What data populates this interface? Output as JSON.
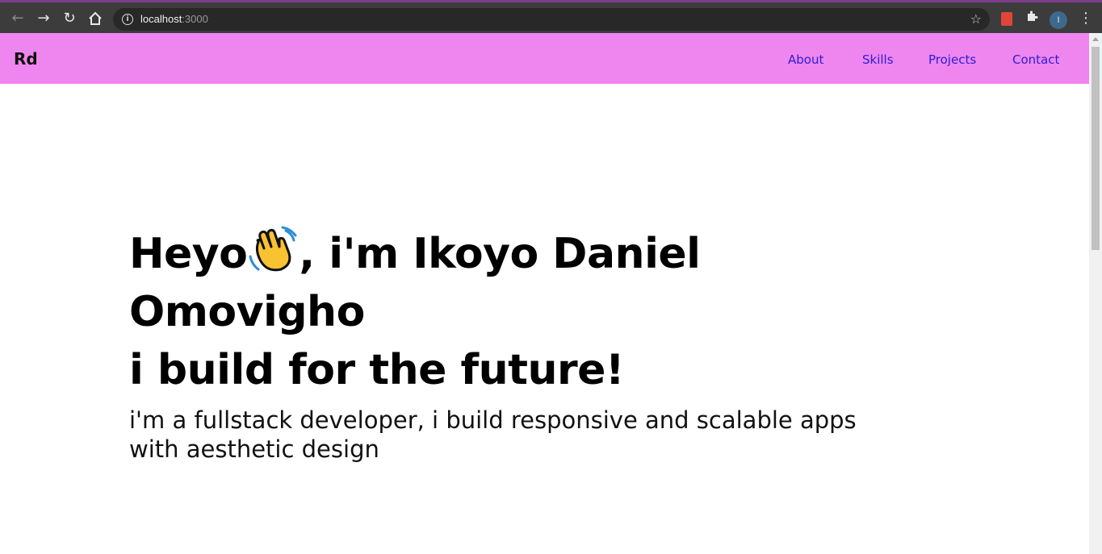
{
  "browser": {
    "url_host": "localhost",
    "url_port": ":3000",
    "profile_initial": "I",
    "icons": {
      "back": "back-arrow-icon",
      "forward": "forward-arrow-icon",
      "reload": "reload-icon",
      "home": "home-icon",
      "info": "info-icon",
      "bookmark": "star-icon",
      "extension": "puzzle-icon",
      "menu": "vertical-dots-icon"
    }
  },
  "navbar": {
    "brand": "Rd",
    "links": [
      "About",
      "Skills",
      "Projects",
      "Contact"
    ],
    "background": "#ef86ef",
    "link_color": "#2b1ed6"
  },
  "hero": {
    "line1_before": "Heyo",
    "line1_after": ", i'm Ikoyo Daniel Omovigho",
    "line2": "i build for the future!",
    "subtitle": "i'm a fullstack developer, i build responsive and scalable apps with aesthetic design",
    "emoji": "waving-hand-icon"
  }
}
